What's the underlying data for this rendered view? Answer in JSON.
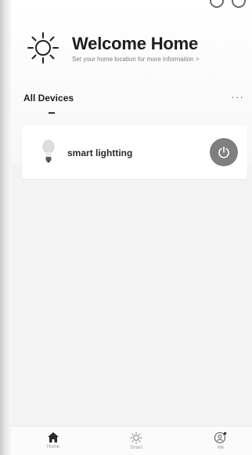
{
  "header": {
    "title": "Welcome Home",
    "subtitle": "Set your home location for more information >"
  },
  "devices_section": {
    "title": "All Devices",
    "more_label": "···"
  },
  "devices": [
    {
      "name": "smart lightting",
      "icon": "bulb-icon"
    }
  ],
  "tabbar": {
    "tabs": [
      {
        "label": "Home",
        "icon": "home-icon"
      },
      {
        "label": "Smart",
        "icon": "smart-sun-icon"
      },
      {
        "label": "Me",
        "icon": "profile-icon"
      }
    ]
  },
  "colors": {
    "power_button": "#7f7f7f",
    "background": "#f3f3f3",
    "card": "#ffffff"
  }
}
